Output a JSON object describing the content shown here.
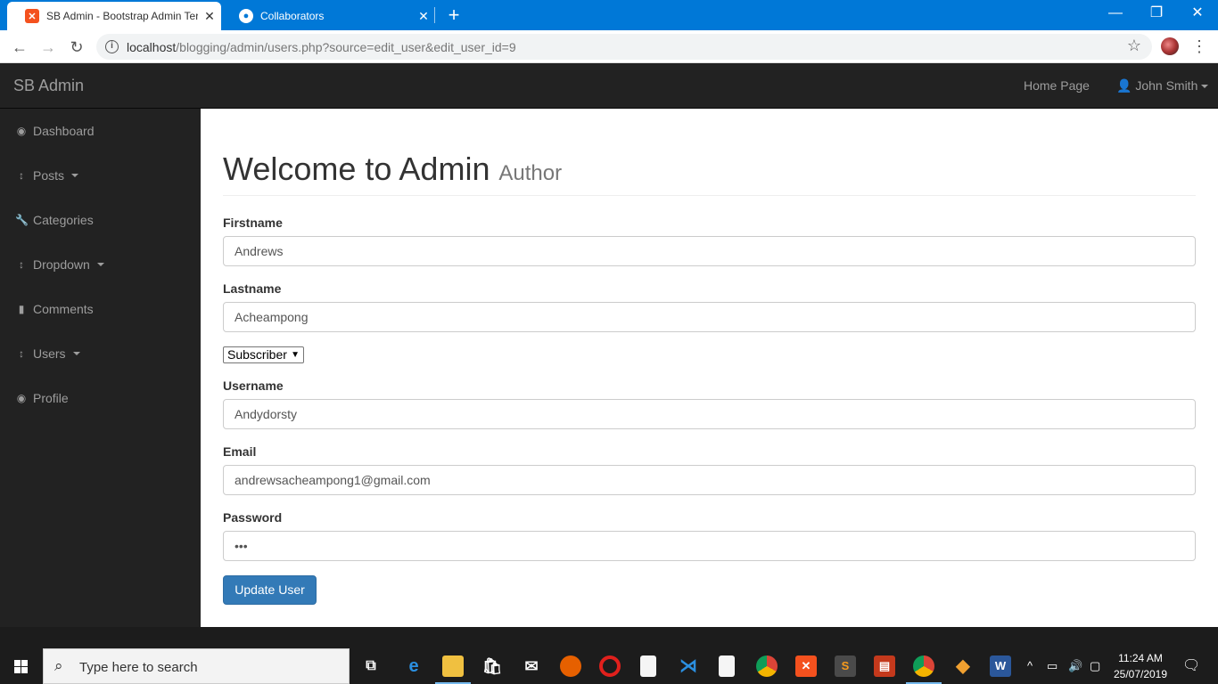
{
  "browser": {
    "tabs": [
      {
        "title": "SB Admin - Bootstrap Admin Ter",
        "favicon": "xampp-icon"
      },
      {
        "title": "Collaborators",
        "favicon": "github-icon"
      }
    ],
    "url_host": "localhost",
    "url_rest": "/blogging/admin/users.php?source=edit_user&edit_user_id=9"
  },
  "navbar": {
    "brand": "SB Admin",
    "home_link": "Home Page",
    "user_menu": "John Smith"
  },
  "sidebar": {
    "items": [
      {
        "label": "Dashboard",
        "icon": "dashboard-icon",
        "dropdown": false
      },
      {
        "label": "Posts",
        "icon": "arrows-v-icon",
        "dropdown": true
      },
      {
        "label": "Categories",
        "icon": "wrench-icon",
        "dropdown": false
      },
      {
        "label": "Dropdown",
        "icon": "arrows-v-icon",
        "dropdown": true
      },
      {
        "label": "Comments",
        "icon": "file-icon",
        "dropdown": false
      },
      {
        "label": "Users",
        "icon": "arrows-v-icon",
        "dropdown": true
      },
      {
        "label": "Profile",
        "icon": "dashboard-icon",
        "dropdown": false
      }
    ]
  },
  "page": {
    "heading": "Welcome to Admin",
    "subheading": "Author"
  },
  "form": {
    "firstname_label": "Firstname",
    "firstname_value": "Andrews",
    "lastname_label": "Lastname",
    "lastname_value": "Acheampong",
    "role_selected": "Subscriber",
    "username_label": "Username",
    "username_value": "Andydorsty",
    "email_label": "Email",
    "email_value": "andrewsacheampong1@gmail.com",
    "password_label": "Password",
    "password_value": "•••",
    "submit_label": "Update User"
  },
  "taskbar": {
    "search_placeholder": "Type here to search",
    "time": "11:24 AM",
    "date": "25/07/2019"
  },
  "colors": {
    "browser_accent": "#0078d7",
    "navbar_bg": "#222222",
    "primary_button": "#337ab7"
  }
}
